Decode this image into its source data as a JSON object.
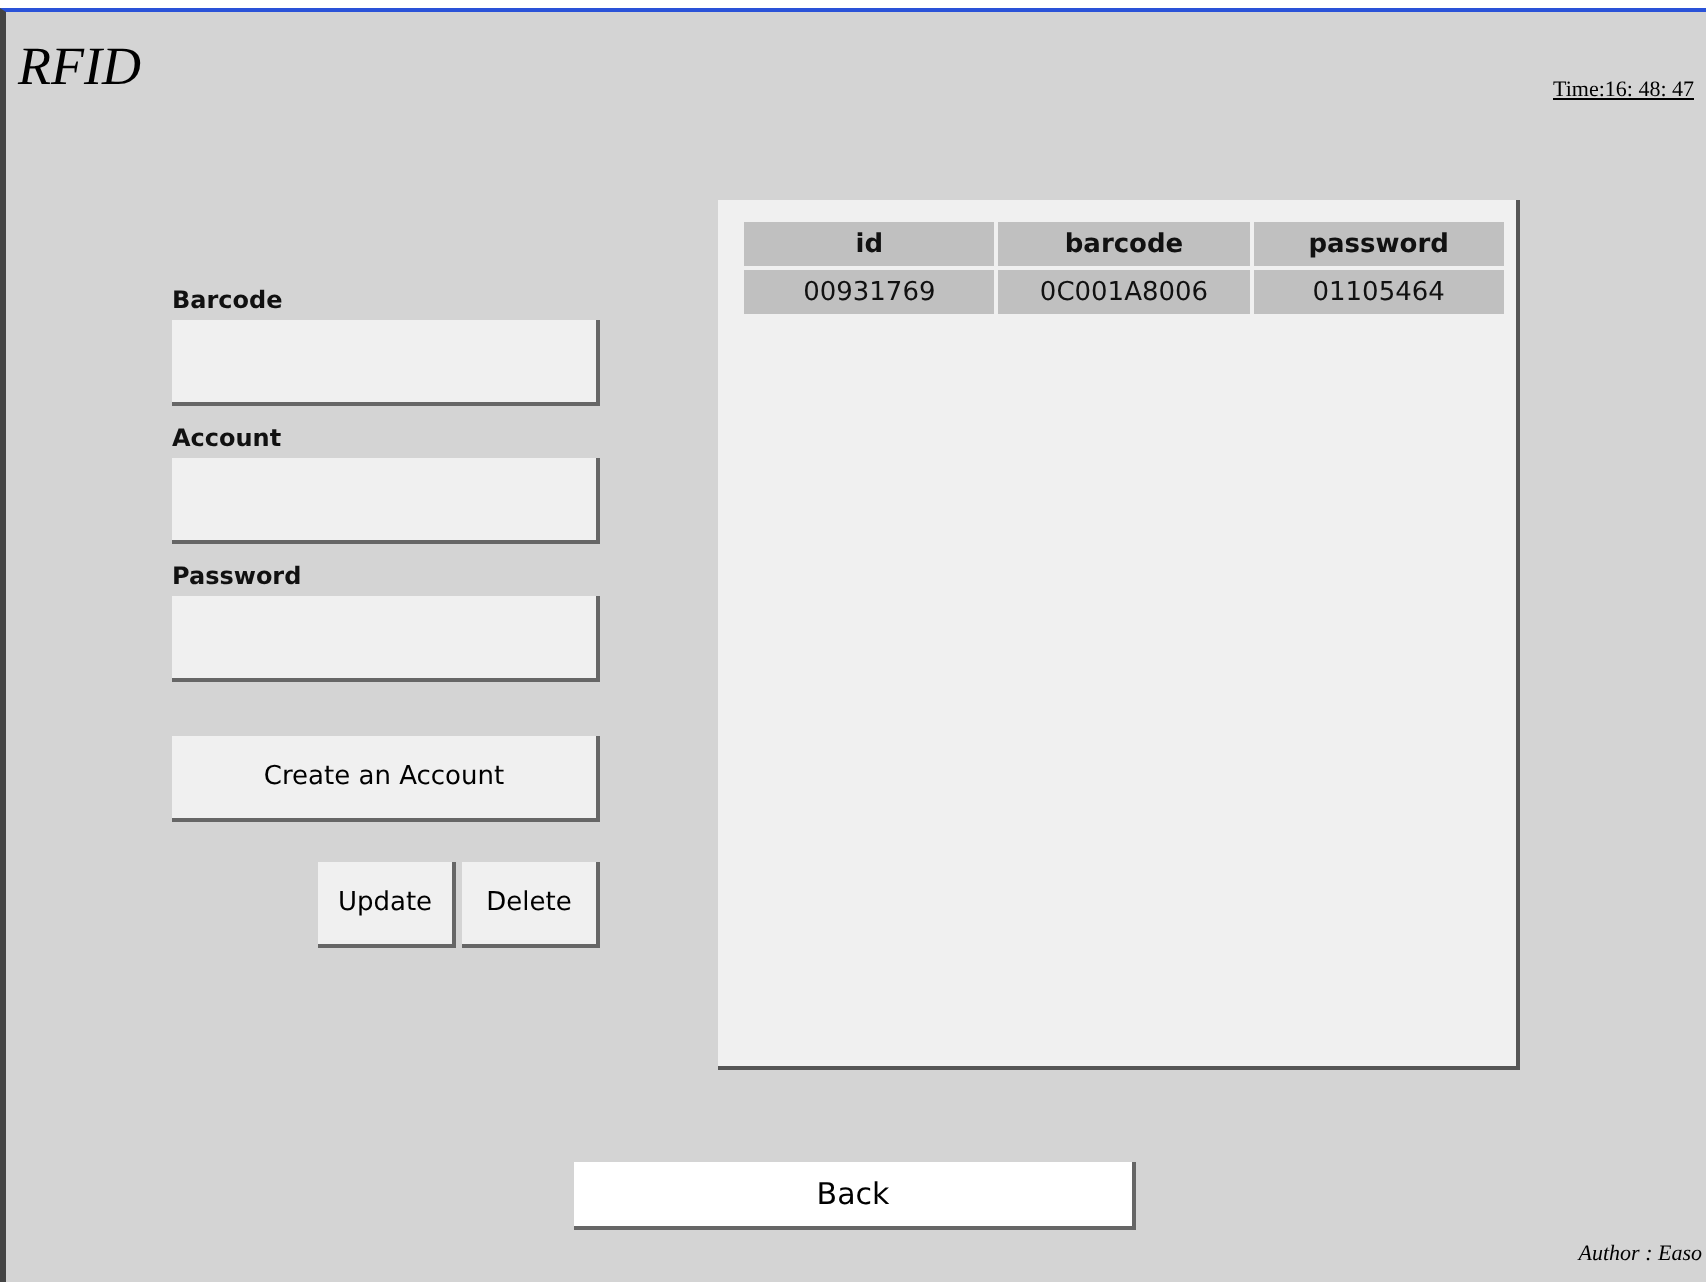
{
  "window": {
    "title": "RFID",
    "time": "Time:16: 48: 47"
  },
  "form": {
    "fields": [
      {
        "label": "Barcode"
      },
      {
        "label": "Account"
      },
      {
        "label": "Password"
      }
    ],
    "create_button": "Create an Account",
    "update_button": "Update",
    "delete_button": "Delete"
  },
  "table": {
    "columns": [
      "id",
      "barcode",
      "password"
    ],
    "rows": [
      [
        "00931769",
        "0C001A8006",
        "01105464"
      ]
    ]
  },
  "back_button": "Back",
  "author": "Author : Easo"
}
